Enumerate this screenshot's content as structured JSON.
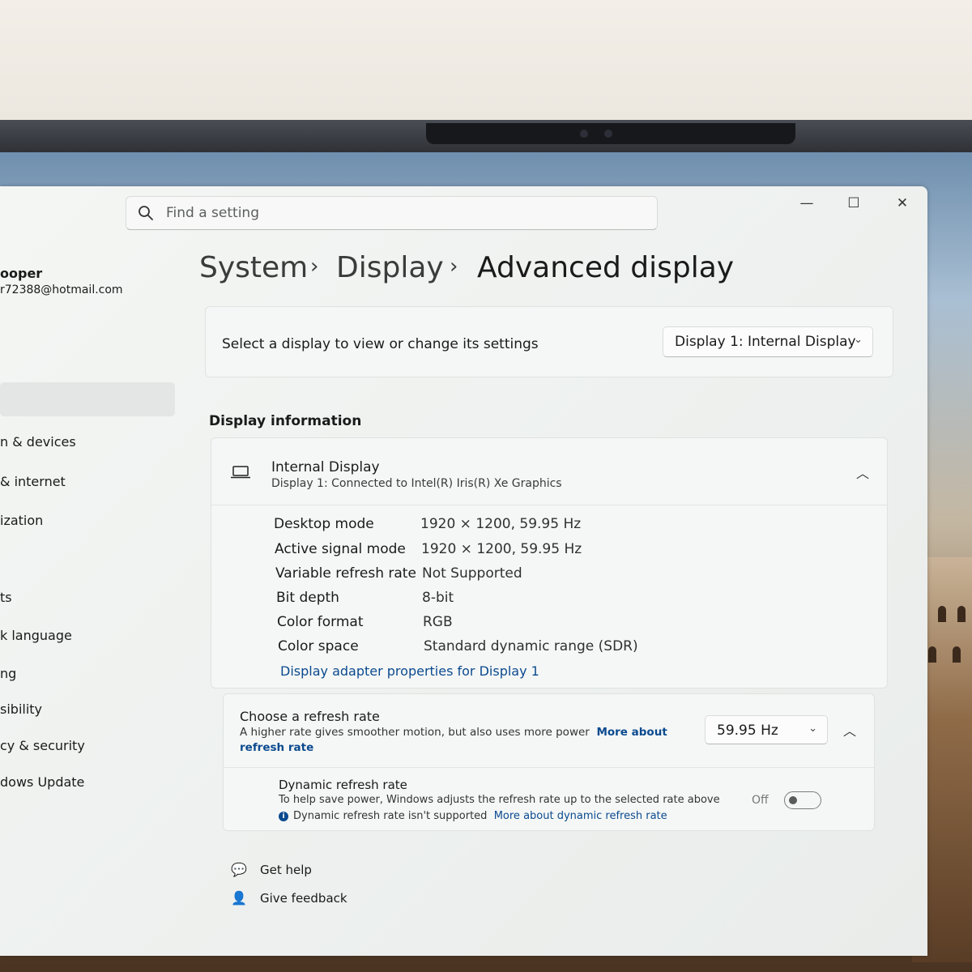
{
  "window": {
    "minimize_glyph": "—",
    "maximize_glyph": "☐",
    "close_glyph": "✕"
  },
  "search": {
    "placeholder": "Find a setting",
    "icon": "search-icon"
  },
  "user": {
    "name": "ooper",
    "email": "r72388@hotmail.com"
  },
  "sidebar": {
    "items": [
      {
        "label": "n & devices"
      },
      {
        "label": "& internet"
      },
      {
        "label": "ization"
      },
      {
        "label": "ts"
      },
      {
        "label": "k language"
      },
      {
        "label": "ng"
      },
      {
        "label": "sibility"
      },
      {
        "label": "cy & security"
      },
      {
        "label": "dows Update"
      }
    ]
  },
  "breadcrumb": {
    "items": [
      "System",
      "Display",
      "Advanced display"
    ],
    "separator": "›"
  },
  "display_select": {
    "label": "Select a display to view or change its settings",
    "selected": "Display 1: Internal Display"
  },
  "display_info": {
    "section_title": "Display information",
    "title": "Internal Display",
    "subtitle": "Display 1: Connected to Intel(R) Iris(R) Xe Graphics",
    "rows": [
      {
        "key": "Desktop mode",
        "value": "1920 × 1200, 59.95 Hz"
      },
      {
        "key": "Active signal mode",
        "value": "1920 × 1200, 59.95 Hz"
      },
      {
        "key": "Variable refresh rate",
        "value": "Not Supported"
      },
      {
        "key": "Bit depth",
        "value": "8-bit"
      },
      {
        "key": "Color format",
        "value": "RGB"
      },
      {
        "key": "Color space",
        "value": "Standard dynamic range (SDR)"
      }
    ],
    "adapter_link": "Display adapter properties for Display 1"
  },
  "refresh": {
    "title": "Choose a refresh rate",
    "description": "A higher rate gives smoother motion, but also uses more power",
    "link": "More about refresh rate",
    "selected": "59.95 Hz",
    "dynamic": {
      "title": "Dynamic refresh rate",
      "description": "To help save power, Windows adjusts the refresh rate up to the selected rate above",
      "note": "Dynamic refresh rate isn't supported",
      "note_link": "More about dynamic refresh rate",
      "toggle_label": "Off",
      "toggle_on": false
    }
  },
  "help": {
    "get_help": "Get help",
    "give_feedback": "Give feedback"
  },
  "colors": {
    "accent_link": "#0b4a8f",
    "window_bg": "#f4f6f4",
    "card_bg": "#f5f7f6"
  }
}
